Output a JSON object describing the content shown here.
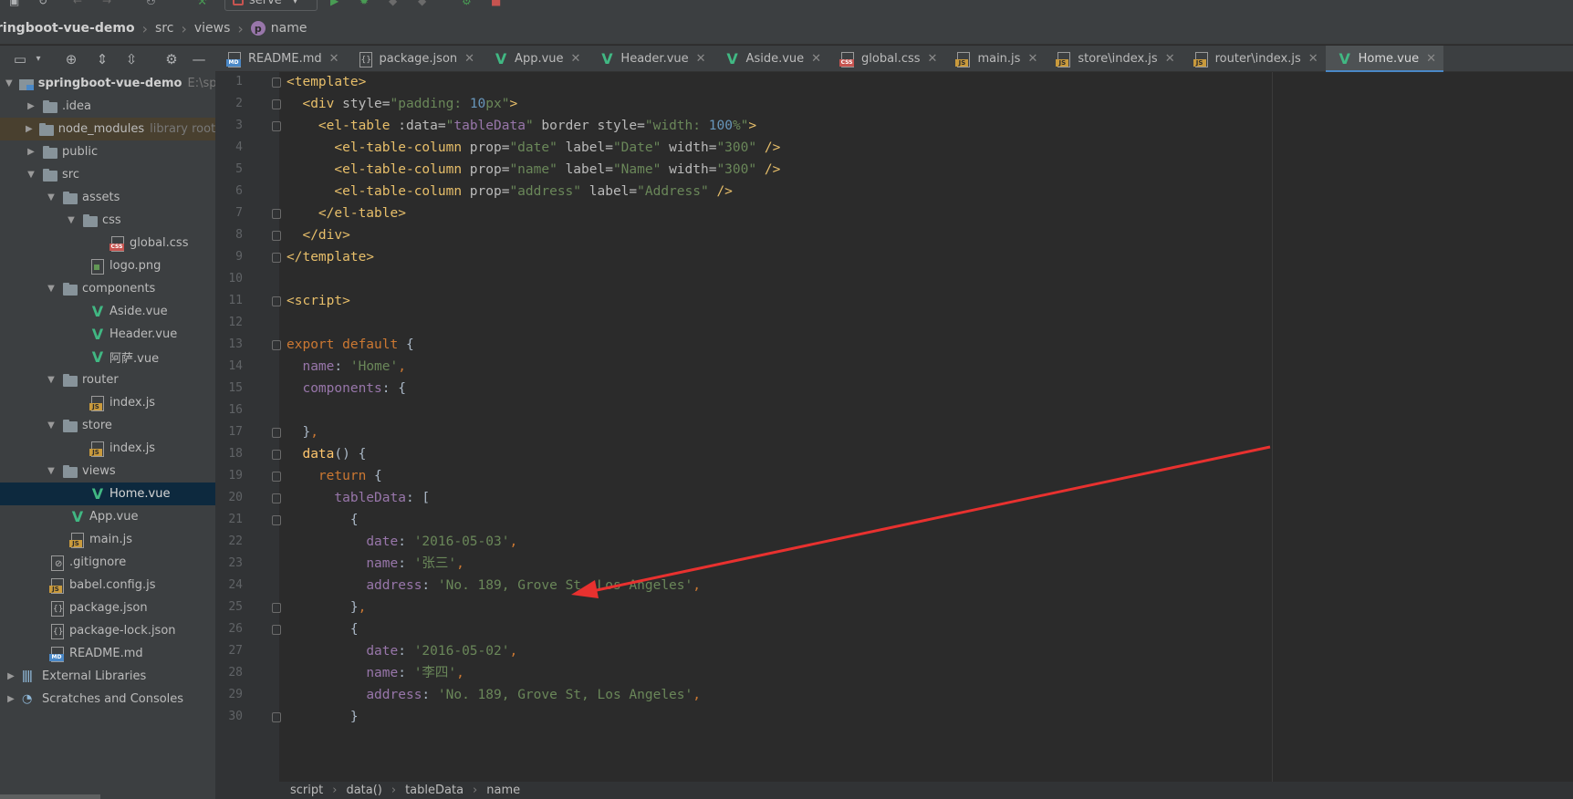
{
  "toolbar": {
    "run_config": "serve"
  },
  "navbar": {
    "project": "ringboot-vue-demo",
    "crumbs": [
      "src",
      "views"
    ],
    "current_icon": "p",
    "current": "name"
  },
  "tree": {
    "items": [
      {
        "label": "springboot-vue-demo",
        "hint": "E:\\sp",
        "icon": "module-icon",
        "expanded": true
      },
      {
        "label": ".idea",
        "icon": "folder-icon"
      },
      {
        "label": "node_modules",
        "hint": "library root",
        "icon": "folder-icon"
      },
      {
        "label": "public",
        "icon": "folder-icon"
      },
      {
        "label": "src",
        "icon": "folder-icon"
      },
      {
        "label": "assets",
        "icon": "folder-icon"
      },
      {
        "label": "css",
        "icon": "folder-icon"
      },
      {
        "label": "global.css",
        "icon": "css-file-icon"
      },
      {
        "label": "logo.png",
        "icon": "image-file-icon"
      },
      {
        "label": "components",
        "icon": "folder-icon"
      },
      {
        "label": "Aside.vue",
        "icon": "vue-icon"
      },
      {
        "label": "Header.vue",
        "icon": "vue-icon"
      },
      {
        "label": "阿萨.vue",
        "icon": "vue-icon"
      },
      {
        "label": "router",
        "icon": "folder-icon"
      },
      {
        "label": "index.js",
        "icon": "js-file-icon"
      },
      {
        "label": "store",
        "icon": "folder-icon"
      },
      {
        "label": "index.js",
        "icon": "js-file-icon"
      },
      {
        "label": "views",
        "icon": "folder-icon"
      },
      {
        "label": "Home.vue",
        "icon": "vue-icon",
        "selected": true
      },
      {
        "label": "App.vue",
        "icon": "vue-icon"
      },
      {
        "label": "main.js",
        "icon": "js-file-icon"
      },
      {
        "label": ".gitignore",
        "icon": "gitignore-file-icon"
      },
      {
        "label": "babel.config.js",
        "icon": "js-file-icon"
      },
      {
        "label": "package.json",
        "icon": "json-file-icon"
      },
      {
        "label": "package-lock.json",
        "icon": "json-file-icon"
      },
      {
        "label": "README.md",
        "icon": "markdown-file-icon"
      },
      {
        "label": "External Libraries",
        "icon": "library-icon"
      },
      {
        "label": "Scratches and Consoles",
        "icon": "scratch-icon"
      }
    ]
  },
  "tabs": [
    {
      "label": "README.md",
      "icon": "markdown-file-icon"
    },
    {
      "label": "package.json",
      "icon": "json-file-icon"
    },
    {
      "label": "App.vue",
      "icon": "vue-icon"
    },
    {
      "label": "Header.vue",
      "icon": "vue-icon"
    },
    {
      "label": "Aside.vue",
      "icon": "vue-icon"
    },
    {
      "label": "global.css",
      "icon": "css-file-icon"
    },
    {
      "label": "main.js",
      "icon": "js-file-icon"
    },
    {
      "label": "store\\index.js",
      "icon": "js-file-icon"
    },
    {
      "label": "router\\index.js",
      "icon": "js-file-icon"
    },
    {
      "label": "Home.vue",
      "icon": "vue-icon",
      "active": true
    }
  ],
  "editor": {
    "line_numbers": [
      "1",
      "2",
      "3",
      "4",
      "5",
      "6",
      "7",
      "8",
      "9",
      "10",
      "11",
      "12",
      "13",
      "14",
      "15",
      "16",
      "17",
      "18",
      "19",
      "20",
      "21",
      "22",
      "23",
      "24",
      "25",
      "26",
      "27",
      "28",
      "29",
      "30"
    ],
    "lines": [
      [
        [
          "tag",
          "<template>"
        ]
      ],
      [
        [
          "plain",
          "  "
        ],
        [
          "tag",
          "<div "
        ],
        [
          "attr",
          "style="
        ],
        [
          "str",
          "\"padding: "
        ],
        [
          "num",
          "10"
        ],
        [
          "str",
          "px\""
        ],
        [
          "tag",
          ">"
        ]
      ],
      [
        [
          "plain",
          "    "
        ],
        [
          "tag",
          "<el-table "
        ],
        [
          "attr",
          ":data="
        ],
        [
          "str",
          "\""
        ],
        [
          "prop",
          "tableData"
        ],
        [
          "str",
          "\""
        ],
        [
          "attr",
          " border style="
        ],
        [
          "str",
          "\"width: "
        ],
        [
          "num",
          "100"
        ],
        [
          "str",
          "%\""
        ],
        [
          "tag",
          ">"
        ]
      ],
      [
        [
          "plain",
          "      "
        ],
        [
          "tag",
          "<el-table-column "
        ],
        [
          "attr",
          "prop="
        ],
        [
          "str",
          "\"date\""
        ],
        [
          "attr",
          " label="
        ],
        [
          "str",
          "\"Date\""
        ],
        [
          "attr",
          " width="
        ],
        [
          "str",
          "\"300\""
        ],
        [
          "tag",
          " />"
        ]
      ],
      [
        [
          "plain",
          "      "
        ],
        [
          "tag",
          "<el-table-column "
        ],
        [
          "attr",
          "prop="
        ],
        [
          "str",
          "\"name\""
        ],
        [
          "attr",
          " label="
        ],
        [
          "str",
          "\"Name\""
        ],
        [
          "attr",
          " width="
        ],
        [
          "str",
          "\"300\""
        ],
        [
          "tag",
          " />"
        ]
      ],
      [
        [
          "plain",
          "      "
        ],
        [
          "tag",
          "<el-table-column "
        ],
        [
          "attr",
          "prop="
        ],
        [
          "str",
          "\"address\""
        ],
        [
          "attr",
          " label="
        ],
        [
          "str",
          "\"Address\""
        ],
        [
          "tag",
          " />"
        ]
      ],
      [
        [
          "plain",
          "    "
        ],
        [
          "tag",
          "</el-table>"
        ]
      ],
      [
        [
          "plain",
          "  "
        ],
        [
          "tag",
          "</div>"
        ]
      ],
      [
        [
          "tag",
          "</template>"
        ]
      ],
      [],
      [
        [
          "tag",
          "<script>"
        ]
      ],
      [],
      [
        [
          "kw",
          "export default "
        ],
        [
          "plain",
          "{"
        ]
      ],
      [
        [
          "plain",
          "  "
        ],
        [
          "prop",
          "name"
        ],
        [
          "plain",
          ": "
        ],
        [
          "str",
          "'Home'"
        ],
        [
          "kw",
          ","
        ]
      ],
      [
        [
          "plain",
          "  "
        ],
        [
          "prop",
          "components"
        ],
        [
          "plain",
          ": {"
        ]
      ],
      [],
      [
        [
          "plain",
          "  }"
        ],
        [
          "kw",
          ","
        ]
      ],
      [
        [
          "plain",
          "  "
        ],
        [
          "fn",
          "data"
        ],
        [
          "plain",
          "() {"
        ]
      ],
      [
        [
          "plain",
          "    "
        ],
        [
          "kw",
          "return "
        ],
        [
          "plain",
          "{"
        ]
      ],
      [
        [
          "plain",
          "      "
        ],
        [
          "prop",
          "tableData"
        ],
        [
          "plain",
          ": ["
        ]
      ],
      [
        [
          "plain",
          "        {"
        ]
      ],
      [
        [
          "plain",
          "          "
        ],
        [
          "prop",
          "date"
        ],
        [
          "plain",
          ": "
        ],
        [
          "str",
          "'2016-05-03'"
        ],
        [
          "kw",
          ","
        ]
      ],
      [
        [
          "plain",
          "          "
        ],
        [
          "prop",
          "name"
        ],
        [
          "plain",
          ": "
        ],
        [
          "str",
          "'张三'"
        ],
        [
          "kw",
          ","
        ]
      ],
      [
        [
          "plain",
          "          "
        ],
        [
          "prop",
          "address"
        ],
        [
          "plain",
          ": "
        ],
        [
          "str",
          "'No. 189, Grove St, Los Angeles'"
        ],
        [
          "kw",
          ","
        ]
      ],
      [
        [
          "plain",
          "        }"
        ],
        [
          "kw",
          ","
        ]
      ],
      [
        [
          "plain",
          "        {"
        ]
      ],
      [
        [
          "plain",
          "          "
        ],
        [
          "prop",
          "date"
        ],
        [
          "plain",
          ": "
        ],
        [
          "str",
          "'2016-05-02'"
        ],
        [
          "kw",
          ","
        ]
      ],
      [
        [
          "plain",
          "          "
        ],
        [
          "prop",
          "name"
        ],
        [
          "plain",
          ": "
        ],
        [
          "str",
          "'李四'"
        ],
        [
          "kw",
          ","
        ]
      ],
      [
        [
          "plain",
          "          "
        ],
        [
          "prop",
          "address"
        ],
        [
          "plain",
          ": "
        ],
        [
          "str",
          "'No. 189, Grove St, Los Angeles'"
        ],
        [
          "kw",
          ","
        ]
      ],
      [
        [
          "plain",
          "        }"
        ]
      ]
    ]
  },
  "bottom_breadcrumb": [
    "script",
    "data()",
    "tableData",
    "name"
  ],
  "colors": {
    "annotation_arrow": "#e8312f",
    "active_tab_underline": "#4a88c7"
  }
}
